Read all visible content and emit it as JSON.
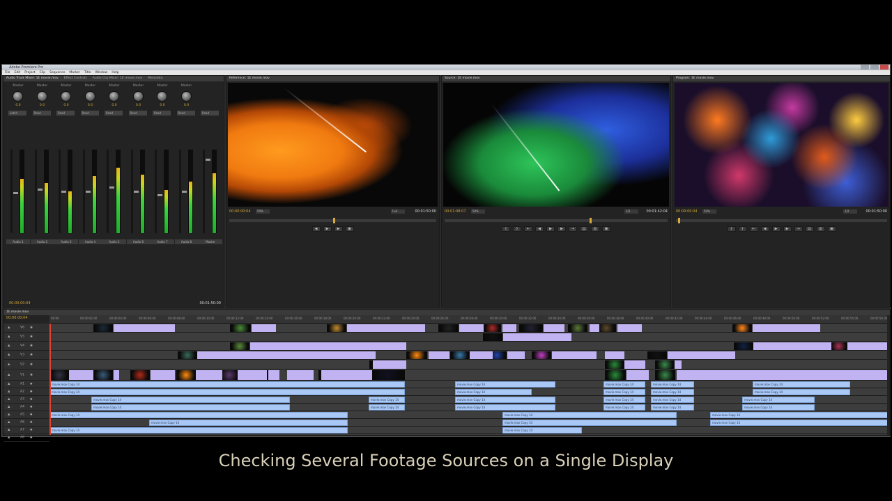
{
  "window": {
    "title": "Adobe Premiere Pro"
  },
  "menu": [
    "File",
    "Edit",
    "Project",
    "Clip",
    "Sequence",
    "Marker",
    "Title",
    "Window",
    "Help"
  ],
  "mixer": {
    "tabs": [
      "Audio Track Mixer: 1E movie.mov",
      "Effect Controls",
      "Audio Clip Mixer: 1E movie.mov",
      "Metadata"
    ],
    "timecode_left": "00:00:00:04",
    "timecode_right": "00:01:50:00",
    "channels": [
      {
        "label": "Master",
        "value": "0.0",
        "auto": "Latch",
        "name": "Audio 1",
        "level": 0.65,
        "fader": 0.52
      },
      {
        "label": "Master",
        "value": "0.0",
        "auto": "Read",
        "name": "Audio 2",
        "level": 0.6,
        "fader": 0.48
      },
      {
        "label": "Master",
        "value": "0.0",
        "auto": "Read",
        "name": "Audio 3",
        "level": 0.5,
        "fader": 0.5
      },
      {
        "label": "Master",
        "value": "0.0",
        "auto": "Read",
        "name": "Audio 4",
        "level": 0.68,
        "fader": 0.5
      },
      {
        "label": "Master",
        "value": "0.0",
        "auto": "Read",
        "name": "Audio 5",
        "level": 0.78,
        "fader": 0.45
      },
      {
        "label": "Master",
        "value": "0.0",
        "auto": "Read",
        "name": "Audio 6",
        "level": 0.7,
        "fader": 0.5
      },
      {
        "label": "Master",
        "value": "0.0",
        "auto": "Read",
        "name": "Audio 7",
        "level": 0.52,
        "fader": 0.55
      },
      {
        "label": "Master",
        "value": "0.0",
        "auto": "Read",
        "name": "Audio 8",
        "level": 0.62,
        "fader": 0.5
      },
      {
        "label": "",
        "value": "",
        "auto": "Read",
        "name": "Master",
        "level": 0.72,
        "fader": 0.1
      }
    ]
  },
  "monitors": [
    {
      "tab": "Reference: 1E movie.mov",
      "tc_left": "00:00:00:04",
      "zoom": "50%",
      "fit": "Full",
      "tc_right": "00:01:50:00",
      "playhead": 0.5
    },
    {
      "tab": "Source: 1E movie.mov",
      "tc_left": "00:01:08:07",
      "zoom": "50%",
      "fit": "1/2",
      "tc_right": "00:01:42:04",
      "playhead": 0.65
    },
    {
      "tab": "Program: 1E movie.mov",
      "tc_left": "00:00:00:04",
      "zoom": "50%",
      "fit": "1/2",
      "tc_right": "00:01:50:00",
      "playhead": 0.01
    }
  ],
  "timeline": {
    "tab": "1E movie.mov",
    "timecode": "00:00:00:04",
    "ticks": [
      "00:00",
      "00:00:02:00",
      "00:00:04:00",
      "00:00:06:00",
      "00:00:08:00",
      "00:00:10:00",
      "00:00:12:00",
      "00:00:14:00",
      "00:00:16:00",
      "00:00:18:00",
      "00:00:20:00",
      "00:00:22:00",
      "00:00:24:00",
      "00:00:26:00",
      "00:00:28:00",
      "00:00:30:00",
      "00:00:32:00",
      "00:00:34:00",
      "00:00:36:00",
      "00:00:38:00",
      "00:00:40:00",
      "00:00:42:00",
      "00:00:44:00",
      "00:00:46:00",
      "00:00:48:00",
      "00:00:50:00",
      "00:00:52:00",
      "00:00:54:00",
      "00:00:56:00"
    ],
    "track_labels": [
      "V6",
      "V5",
      "V4",
      "V3",
      "V2",
      "V1",
      "A1",
      "A2",
      "A3",
      "A4",
      "A5",
      "A6",
      "A7",
      "A8"
    ],
    "audio_clip_label": "movie.mov Copy 14"
  },
  "caption": "Checking Several Footage Sources on a Single Display"
}
